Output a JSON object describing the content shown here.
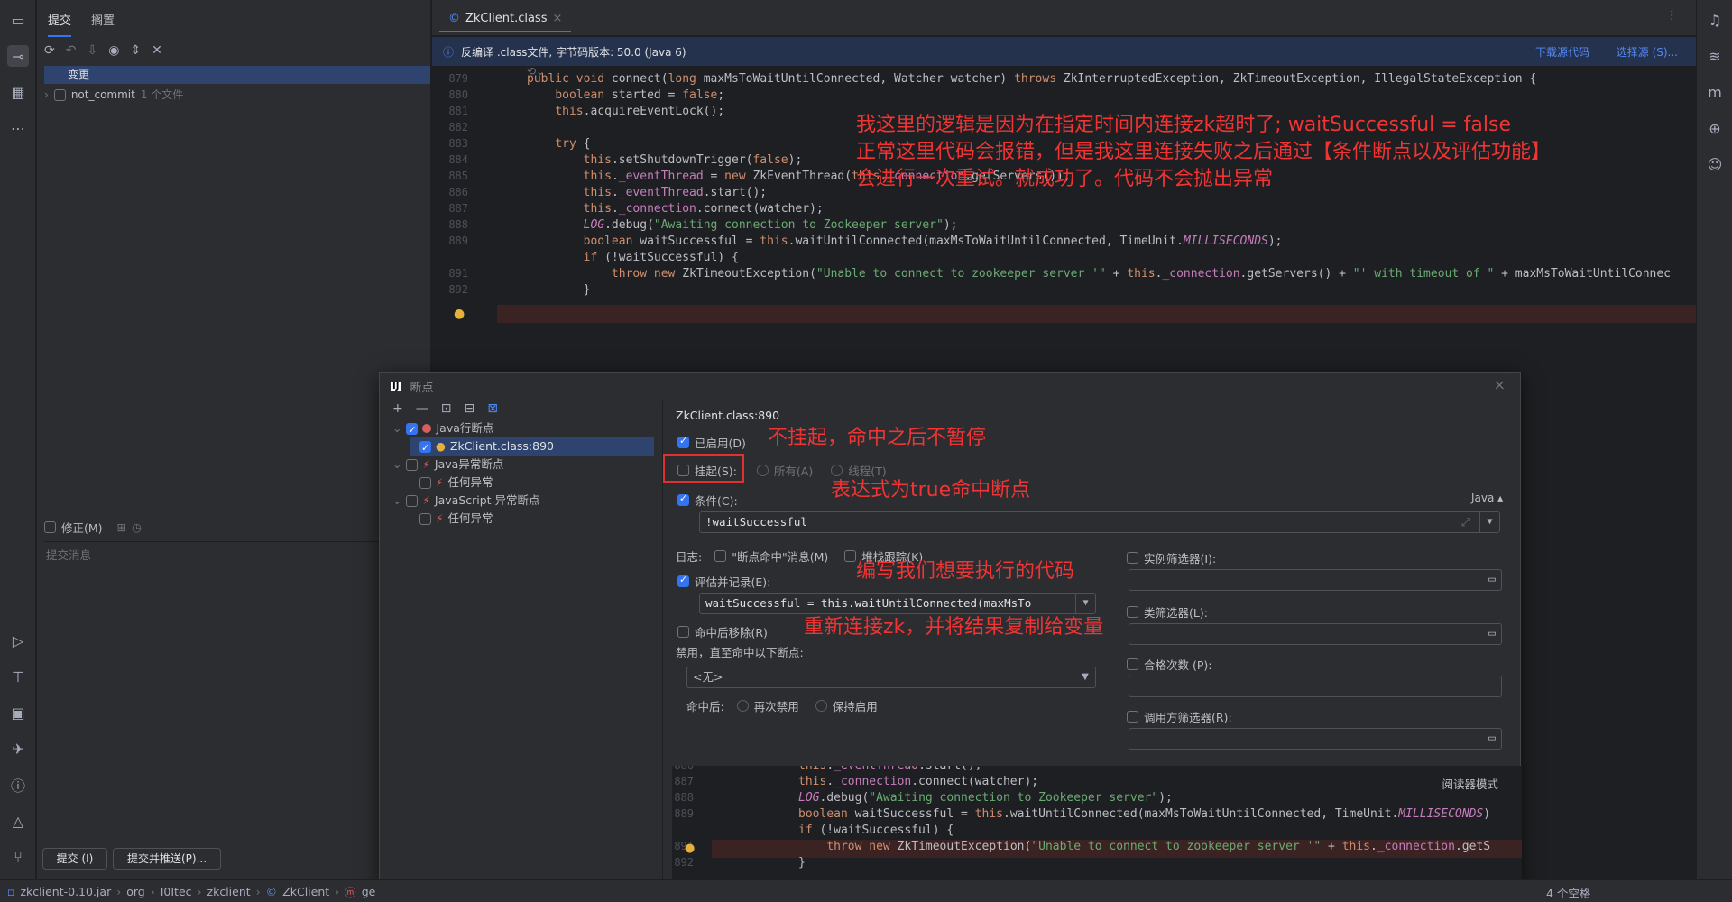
{
  "commit_panel": {
    "tabs": [
      "提交",
      "搁置"
    ],
    "changes_label": "变更",
    "not_commit_label": "not_commit",
    "not_commit_count": "1 个文件",
    "amend_label": "修正(M)",
    "commit_msg_placeholder": "提交消息",
    "commit_button": "提交 (I)",
    "commit_push_button": "提交并推送(P)..."
  },
  "editor": {
    "tab_title": "ZkClient.class",
    "info_text": "反编译 .class文件, 字节码版本: 50.0 (Java 6)",
    "download_link": "下载源代码",
    "choose_link": "选择源 (S)...",
    "lines": [
      {
        "n": "879",
        "t": "public void connect(long maxMsToWaitUntilConnected, Watcher watcher) throws ZkInterruptedException, ZkTimeoutException, IllegalStateException {"
      },
      {
        "n": "880",
        "t": "    boolean started = false;"
      },
      {
        "n": "881",
        "t": "    this.acquireEventLock();"
      },
      {
        "n": "882",
        "t": ""
      },
      {
        "n": "883",
        "t": "    try {"
      },
      {
        "n": "884",
        "t": "        this.setShutdownTrigger(false);"
      },
      {
        "n": "885",
        "t": "        this._eventThread = new ZkEventThread(this._connection.getServers());"
      },
      {
        "n": "886",
        "t": "        this._eventThread.start();"
      },
      {
        "n": "887",
        "t": "        this._connection.connect(watcher);"
      },
      {
        "n": "888",
        "t": "        LOG.debug(\"Awaiting connection to Zookeeper server\");"
      },
      {
        "n": "889",
        "t": "        boolean waitSuccessful = this.waitUntilConnected(maxMsToWaitUntilConnected, TimeUnit.MILLISECONDS);"
      },
      {
        "n": "",
        "t": "        if (!waitSuccessful) {"
      },
      {
        "n": "891",
        "t": "            throw new ZkTimeoutException(\"Unable to connect to zookeeper server '\" + this._connection.getServers() + \"' with timeout of \" + maxMsToWaitUntilConnec"
      },
      {
        "n": "892",
        "t": "        }"
      }
    ],
    "annotation": [
      "我这里的逻辑是因为在指定时间内连接zk超时了; waitSuccessful = false",
      "正常这里代码会报错，但是我这里连接失败之后通过【条件断点以及评估功能】",
      "会进行一次重试。就成功了。代码不会抛出异常"
    ]
  },
  "dialog": {
    "title": "断点",
    "tree": [
      {
        "label": "Java行断点",
        "level": 0
      },
      {
        "label": "ZkClient.class:890",
        "level": 1
      },
      {
        "label": "Java异常断点",
        "level": 0
      },
      {
        "label": "任何异常",
        "level": 1
      },
      {
        "label": "JavaScript 异常断点",
        "level": 0
      },
      {
        "label": "任何异常",
        "level": 1
      }
    ],
    "heading": "ZkClient.class:890",
    "enabled_label": "已启用(D)",
    "suspend_label": "挂起(S):",
    "all_label": "所有(A)",
    "thread_label": "线程(T)",
    "condition_label": "条件(C):",
    "condition_lang": "Java ▴",
    "condition_value": "!waitSuccessful",
    "log_label": "日志:",
    "log_msg_label": "\"断点命中\"消息(M)",
    "stack_label": "堆栈跟踪(K)",
    "evaluate_label": "评估并记录(E):",
    "evaluate_value": "waitSuccessful = this.waitUntilConnected(maxMsTo",
    "remove_label": "命中后移除(R)",
    "disable_label": "禁用，直至命中以下断点:",
    "disable_value": "<无>",
    "after_hit_label": "命中后:",
    "disable_again_label": "再次禁用",
    "keep_enabled_label": "保持启用",
    "instance_filter_label": "实例筛选器(I):",
    "class_filter_label": "类筛选器(L):",
    "pass_count_label": "合格次数 (P):",
    "caller_filter_label": "调用方筛选器(R):",
    "reader_mode": "阅读器模式",
    "annotations": {
      "no_suspend": "不挂起，命中之后不暂停",
      "condition": "表达式为true命中断点",
      "evaluate": "编写我们想要执行的代码",
      "reconnect": "重新连接zk，并将结果复制给变量"
    },
    "preview_lines": [
      {
        "n": "886",
        "t": "this._eventThread.start();"
      },
      {
        "n": "887",
        "t": "this._connection.connect(watcher);"
      },
      {
        "n": "888",
        "t": "LOG.debug(\"Awaiting connection to Zookeeper server\");"
      },
      {
        "n": "889",
        "t": "boolean waitSuccessful = this.waitUntilConnected(maxMsToWaitUntilConnected, TimeUnit.MILLISECONDS)"
      },
      {
        "n": "",
        "t": "if (!waitSuccessful) {"
      },
      {
        "n": "891",
        "t": "    throw new ZkTimeoutException(\"Unable to connect to zookeeper server '\" + this._connection.getS"
      },
      {
        "n": "892",
        "t": "}"
      }
    ]
  },
  "status_bar": {
    "crumbs": [
      "zkclient-0.10.jar",
      "org",
      "I0Itec",
      "zkclient",
      "ZkClient",
      "ge"
    ],
    "right_text": "4 个空格"
  }
}
